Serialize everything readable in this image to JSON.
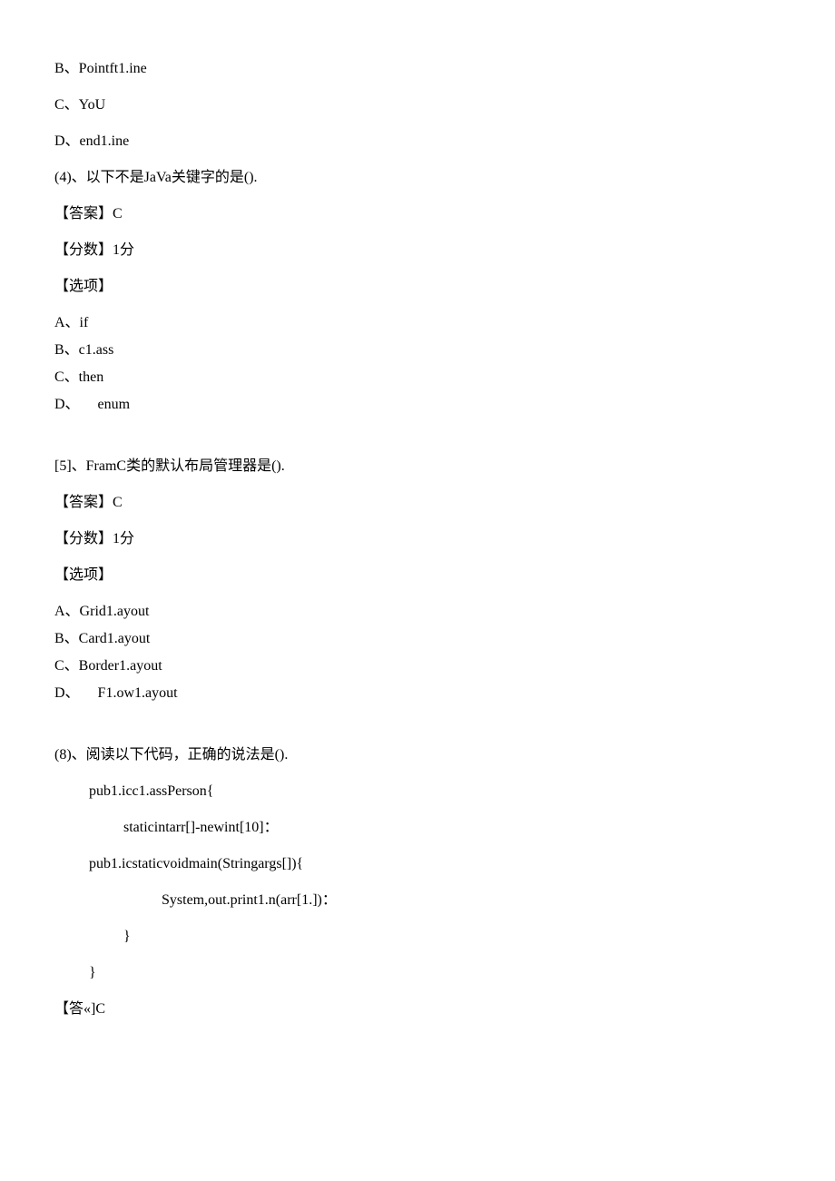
{
  "lines": {
    "l1": "B、Pointft1.ine",
    "l2": "C、YoU",
    "l3": "D、end1.ine",
    "l4": "(4)、以下不是JaVa关键字的是().",
    "l5": "【答案】C",
    "l6": "【分数】1分",
    "l7": "【选项】",
    "l8": "A、if",
    "l9": "B、c1.ass",
    "l10": "C、then",
    "l11": "D、     enum",
    "l12": "[5]、FramC类的默认布局管理器是().",
    "l13": "【答案】C",
    "l14": "【分数】1分",
    "l15": "【选项】",
    "l16": "A、Grid1.ayout",
    "l17": "B、Card1.ayout",
    "l18": "C、Border1.ayout",
    "l19": "D、     F1.ow1.ayout",
    "l20": "(8)、阅读以下代码，正确的说法是().",
    "l21": "pub1.icc1.assPerson{",
    "l22": "staticintarr[]-newint[10]：",
    "l23": "pub1.icstaticvoidmain(Stringargs[]){",
    "l24": "System,out.print1.n(arr[1.])：",
    "l25": "}",
    "l26": "}",
    "l27": "【答«]C"
  }
}
